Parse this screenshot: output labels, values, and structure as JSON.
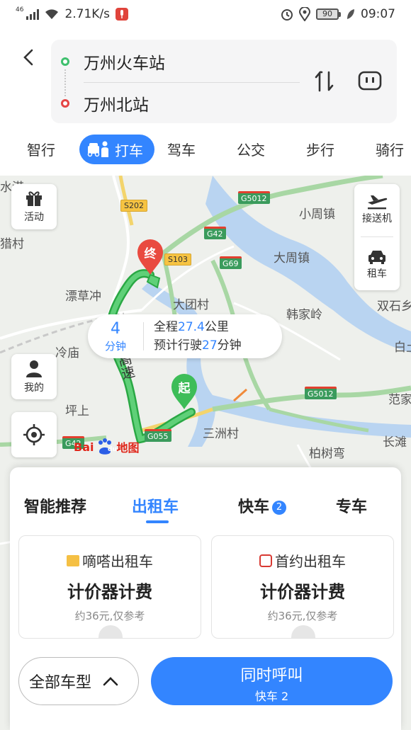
{
  "status_bar": {
    "network": "46",
    "speed": "2.71K/s",
    "battery": "90",
    "time": "09:07"
  },
  "route": {
    "origin": "万州火车站",
    "destination": "万州北站"
  },
  "modes": [
    {
      "label": "智行"
    },
    {
      "label": "打车",
      "active": true
    },
    {
      "label": "驾车"
    },
    {
      "label": "公交"
    },
    {
      "label": "步行"
    },
    {
      "label": "骑行"
    }
  ],
  "map": {
    "labels": [
      "水港",
      "猎村",
      "小周镇",
      "大周镇",
      "漂草冲",
      "大团村",
      "韩家岭",
      "双石乡",
      "冷庙",
      "白土",
      "坪上",
      "范家",
      "三洲村",
      "长滩",
      "柏树弯",
      "高速"
    ],
    "road_tags": [
      "S202",
      "G5012",
      "G42",
      "S103",
      "G69",
      "G5012",
      "G055",
      "G42"
    ],
    "side_buttons": {
      "activity": "活动",
      "airport": "接送机",
      "rental": "租车",
      "mine": "我的"
    },
    "trip": {
      "minutes": "4",
      "minutes_unit": "分钟",
      "distance_prefix": "全程",
      "distance": "27.4",
      "distance_unit": "公里",
      "time_prefix": "预计行驶",
      "time": "27",
      "time_unit": "分钟"
    },
    "pins": {
      "end": "终",
      "start": "起"
    },
    "logo": {
      "bai": "Bai",
      "du": "du",
      "text": "地图"
    }
  },
  "sheet": {
    "tabs": [
      {
        "label": "智能推荐"
      },
      {
        "label": "出租车",
        "active": true
      },
      {
        "label": "快车",
        "badge": "2"
      },
      {
        "label": "专车"
      }
    ],
    "cards": [
      {
        "name": "嘀嗒出租车",
        "fee": "计价器计费",
        "estimate": "约36元,仅参考"
      },
      {
        "name": "首约出租车",
        "fee": "计价器计费",
        "estimate": "约36元,仅参考"
      }
    ],
    "car_type": "全部车型",
    "call": {
      "main": "同时呼叫",
      "sub": "快车 2"
    }
  },
  "colors": {
    "accent": "#3385ff",
    "route_green": "#3dbd58",
    "end_red": "#e94a3f"
  }
}
